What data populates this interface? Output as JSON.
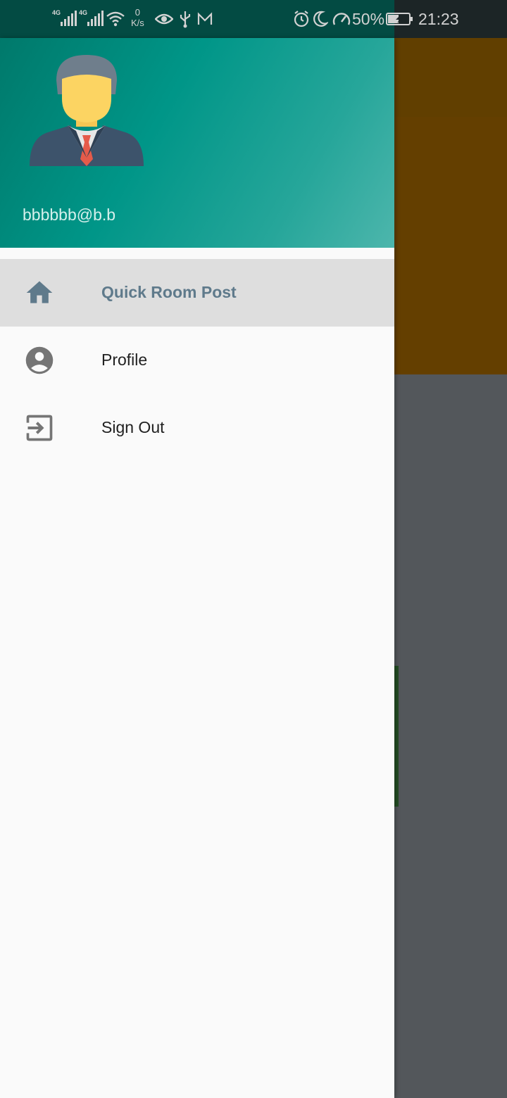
{
  "status_bar": {
    "net1": "4G",
    "net2": "4G",
    "speed_value": "0",
    "speed_unit": "K/s",
    "battery": "50%",
    "time": "21:23"
  },
  "drawer": {
    "header": {
      "email": "bbbbbb@b.b"
    },
    "items": [
      {
        "label": "Quick Room Post",
        "icon": "home-icon",
        "selected": true
      },
      {
        "label": "Profile",
        "icon": "account-circle-icon",
        "selected": false
      },
      {
        "label": "Sign Out",
        "icon": "sign-out-icon",
        "selected": false
      }
    ]
  },
  "colors": {
    "header_start": "#00796b",
    "header_end": "#4db6ac",
    "selected_item_bg": "#dedede",
    "selected_item_text": "#5f7a8b",
    "scrim_bg": "#53575b"
  }
}
